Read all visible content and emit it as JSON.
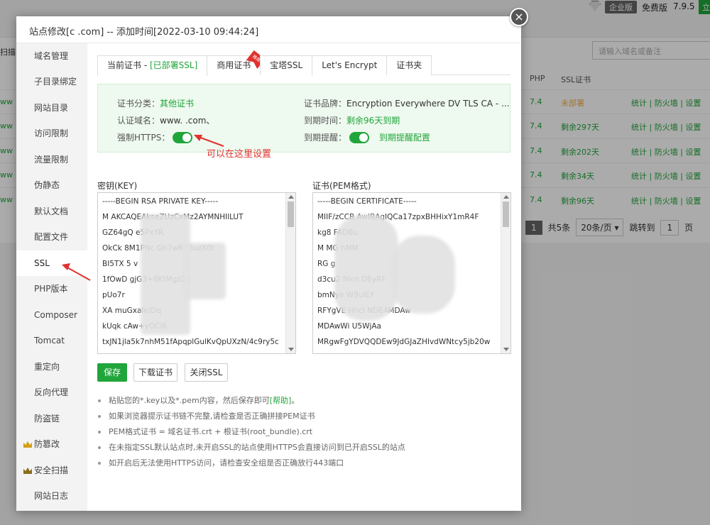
{
  "bg": {
    "edition_label": "企业版",
    "free_label": "免费版",
    "version": "7.9.5",
    "upgrade_label": "立",
    "search_placeholder": "请输入域名或备注",
    "left_label": "扫描",
    "col_php": "PHP",
    "col_ssl": "SSL证书",
    "rows": [
      {
        "domain": "ww",
        "php": "7.4",
        "ssl": "未部署",
        "ops": "统计 | 防火墙 | 设置"
      },
      {
        "domain": "ww",
        "php": "7.4",
        "ssl": "剩余297天",
        "ops": "统计 | 防火墙 | 设置"
      },
      {
        "domain": "ww",
        "php": "7.4",
        "ssl": "剩余202天",
        "ops": "统计 | 防火墙 | 设置"
      },
      {
        "domain": "ww",
        "php": "7.4",
        "ssl": "剩余34天",
        "ops": "统计 | 防火墙 | 设置"
      },
      {
        "domain": "ww",
        "php": "7.4",
        "ssl": "剩余96天",
        "ops": "统计 | 防火墙 | 设置"
      }
    ],
    "pager": {
      "current": "1",
      "total": "共5条",
      "per_page": "20条/页",
      "goto": "跳转到",
      "goto_value": "1",
      "page_suffix": "页"
    }
  },
  "modal": {
    "title": "站点修改[c            .com] -- 添加时间[2022-03-10 09:44:24]",
    "close_glyph": "×",
    "sidebar": [
      "域名管理",
      "子目录绑定",
      "网站目录",
      "访问限制",
      "流量限制",
      "伪静态",
      "默认文档",
      "配置文件",
      "SSL",
      "PHP版本",
      "Composer",
      "Tomcat",
      "重定向",
      "反向代理",
      "防盗链",
      "防篡改",
      "安全扫描",
      "网站日志"
    ],
    "tabs": {
      "current_prefix": "当前证书 - ",
      "current_status": "[已部署SSL]",
      "commercial": "商用证书",
      "commercial_badge": "推荐",
      "baota": "宝塔SSL",
      "letsencrypt": "Let's Encrypt",
      "folder": "证书夹"
    },
    "info": {
      "category_label": "证书分类：",
      "category_value": "其他证书",
      "brand_label": "证书品牌：",
      "brand_value": "Encryption Everywhere DV TLS CA - ...",
      "domain_label": "认证域名：",
      "domain_value": "www.           .com、",
      "expire_label": "到期时间：",
      "expire_value": "剩余96天到期",
      "https_label": "强制HTTPS：",
      "remind_label": "到期提醒：",
      "remind_link": "到期提醒配置"
    },
    "annotation": "可以在这里设置",
    "key": {
      "label": "密钥(KEY)",
      "lines": [
        "-----BEGIN RSA PRIVATE KEY-----",
        "M          AKCAQEAkseZUzCxMz2AYMNHIlLUT",
        "GZ64gQ                        e5PxYR",
        "OkCk             8M1PNc        Gh7wRX3uzX0i",
        "BI5TX        5                        v",
        "1fOwD                          gjG3+8KtMgzZ6",
        "pUo7r",
        "XA                             muGxale/Dq",
        "kUqk      cAw+yOCl6",
        "txJN1jla5k7nhM51fApqplGulKvQpUXzN/4c9ry5c"
      ]
    },
    "cert": {
      "label": "证书(PEM格式)",
      "lines": [
        "-----BEGIN CERTIFICATE-----",
        "MIIF/zCCB      AwIBAgIQCa17zpxBHHixY1mR4F",
        "kg8               FADBu",
        "M                            MG        hMM",
        "RG             g",
        "d3cu2          Nlcn                    DEyRF",
        "bmNye         W9ulEY",
        "RFYgVE                Hhcl        NDE4MDAw",
        "MDAwWi                          U5WjAa",
        "MRgwFgYDVQQDEw9JdGJaZHIvdWNtcy5jb20w"
      ]
    },
    "buttons": {
      "save": "保存",
      "download": "下载证书",
      "close_ssl": "关闭SSL"
    },
    "tips": [
      {
        "text": "粘贴您的*.key以及*.pem内容，然后保存即可",
        "help": "[帮助]",
        "tail": "。"
      },
      {
        "text": "如果浏览器提示证书链不完整,请检查是否正确拼接PEM证书",
        "help": "",
        "tail": ""
      },
      {
        "text": "PEM格式证书 = 域名证书.crt + 根证书(root_bundle).crt",
        "help": "",
        "tail": ""
      },
      {
        "text": "在未指定SSL默认站点时,未开启SSL的站点使用HTTPS会直接访问到已开启SSL的站点",
        "help": "",
        "tail": ""
      },
      {
        "text": "如开启后无法使用HTTPS访问，请检查安全组是否正确放行443端口",
        "help": "",
        "tail": ""
      }
    ]
  },
  "colors": {
    "accent": "#20a53a",
    "annotation": "#e0322f",
    "warn": "#f0ad4e"
  }
}
